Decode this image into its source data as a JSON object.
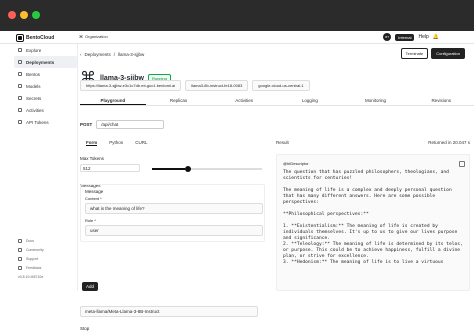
{
  "app": {
    "brand": "BentoCloud",
    "organization": "Organization",
    "header_right": [
      "Internal",
      "Help"
    ]
  },
  "sidebar": {
    "items": [
      {
        "label": "Explore"
      },
      {
        "label": "Deployments"
      },
      {
        "label": "Bentos"
      },
      {
        "label": "Models"
      },
      {
        "label": "Secrets"
      },
      {
        "label": "Activities"
      },
      {
        "label": "API Tokens"
      }
    ],
    "bottom": [
      {
        "label": "Docs"
      },
      {
        "label": "Community"
      },
      {
        "label": "Support"
      },
      {
        "label": "Feedback"
      }
    ],
    "version": "v0.8.19-f45710e"
  },
  "breadcrumb": [
    "Deployments",
    "llama-3-sjjbw"
  ],
  "top_buttons": {
    "terminate": "Terminate",
    "configuration": "Configuration"
  },
  "deployment": {
    "title": "llama-3-sjjbw",
    "status": "Running",
    "urls": [
      "https://llama-3-sjjbw-e3c1c7db.mt-guc1.bentoml.ai",
      "llama3-8b-instruct-fe18-0083",
      "google-cloud-us-central-1"
    ]
  },
  "tabs": [
    "Playground",
    "Replicas",
    "Activities",
    "Logging",
    "Monitoring",
    "Revisions"
  ],
  "request": {
    "method": "POST",
    "path": "/api/chat"
  },
  "form": {
    "tabs": [
      "Form",
      "Python",
      "CURL"
    ],
    "max_tokens_label": "Max Tokens",
    "max_tokens_value": "512",
    "messages_label": "Messages",
    "message_label": "Message",
    "content_label": "Content *",
    "content_value": "what is the meaning of life?",
    "role_label": "Role *",
    "role_value": "user",
    "add_label": "Add",
    "model_label": "Model",
    "model_value": "meta-llama/Meta-Llama-3-8B-Instruct",
    "stop_label": "Stop"
  },
  "result": {
    "title": "Result",
    "returned": "Returned in 20.047 s",
    "descriptor": "@htDescriptor",
    "text": "The question that has puzzled philosophers, theologians, and scientists for centuries!\n\nThe meaning of life is a complex and deeply personal question that has many different answers. Here are some possible perspectives:\n\n**Philosophical perspectives:**\n\n1. **Existentialism:** The meaning of life is created by individuals themselves. It's up to us to give our lives purpose and significance.\n2. **Teleology:** The meaning of life is determined by its telos, or purpose. This could be to achieve happiness, fulfill a divine plan, or strive for excellence.\n3. **Hedonism:** The meaning of life is to live a virtuous"
  }
}
